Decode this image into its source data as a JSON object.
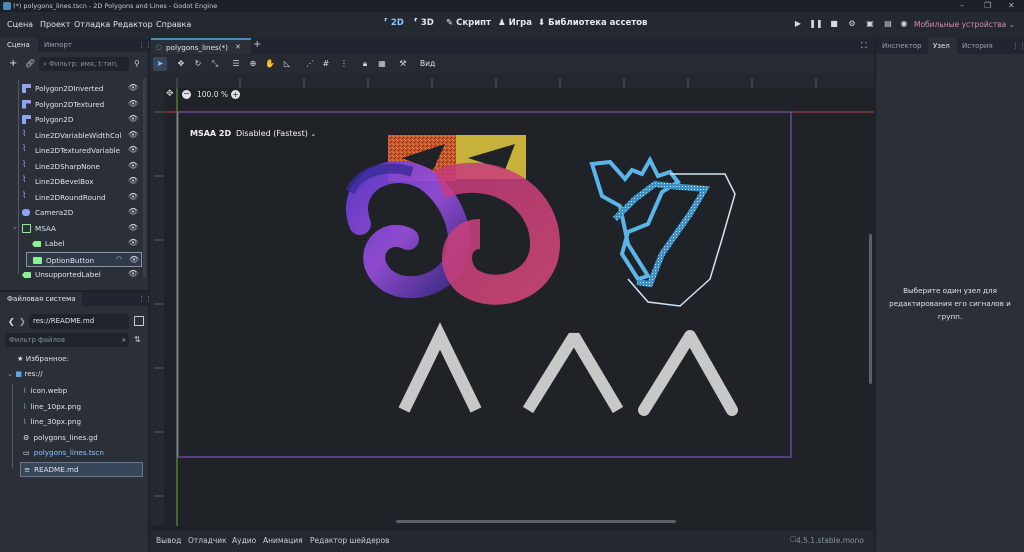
{
  "window": {
    "title": "(*) polygons_lines.tscn - 2D Polygons and Lines - Godot Engine"
  },
  "menu": [
    "Сцена",
    "Проект",
    "Отладка",
    "Редактор",
    "Справка"
  ],
  "workspaces": {
    "w2d": "2D",
    "w3d": "3D",
    "script": "Скрипт",
    "game": "Игра",
    "assets": "Библиотека ассетов"
  },
  "renderer": "Мобильные устройства",
  "scene_panel": {
    "tab_scene": "Сцена",
    "tab_import": "Импорт",
    "filter_placeholder": "Фильтр: имя, t:тип,",
    "nodes": [
      {
        "label": "Polygon2DInverted",
        "icon": "polygon2d-icon",
        "color": "#8da5f3"
      },
      {
        "label": "Polygon2DTextured",
        "icon": "polygon2d-icon",
        "color": "#8da5f3"
      },
      {
        "label": "Polygon2D",
        "icon": "polygon2d-icon",
        "color": "#8da5f3"
      },
      {
        "label": "Line2DVariableWidthCol",
        "icon": "line2d-icon",
        "color": "#8da5f3"
      },
      {
        "label": "Line2DTexturedVariable",
        "icon": "line2d-icon",
        "color": "#8da5f3"
      },
      {
        "label": "Line2DSharpNone",
        "icon": "line2d-icon",
        "color": "#8da5f3"
      },
      {
        "label": "Line2DBevelBox",
        "icon": "line2d-icon",
        "color": "#8da5f3"
      },
      {
        "label": "Line2DRoundRound",
        "icon": "line2d-icon",
        "color": "#8da5f3"
      },
      {
        "label": "Camera2D",
        "icon": "camera2d-icon",
        "color": "#8da5f3"
      },
      {
        "label": "MSAA",
        "icon": "container-icon",
        "color": "#8eef97"
      },
      {
        "label": "Label",
        "icon": "label-icon",
        "color": "#8eef97"
      },
      {
        "label": "OptionButton",
        "icon": "optionbutton-icon",
        "color": "#8eef97"
      },
      {
        "label": "UnsupportedLabel",
        "icon": "label-icon",
        "color": "#8eef97"
      }
    ]
  },
  "fs_panel": {
    "title": "Файловая система",
    "path": "res://README.md",
    "filter_placeholder": "Фильтр файлов",
    "favorites": "Избранное:",
    "root": "res://",
    "files": [
      {
        "label": "icon.webp",
        "icon": "image-icon"
      },
      {
        "label": "line_10px.png",
        "icon": "image-icon"
      },
      {
        "label": "line_30px.png",
        "icon": "image-icon"
      },
      {
        "label": "polygons_lines.gd",
        "icon": "gear-icon"
      },
      {
        "label": "polygons_lines.tscn",
        "icon": "scene-icon"
      },
      {
        "label": "README.md",
        "icon": "textfile-icon"
      }
    ]
  },
  "editor_tab": "polygons_lines(*)",
  "toolbar": {
    "view": "Вид"
  },
  "viewport": {
    "zoom": "100.0 %",
    "msaa_label": "MSAA 2D",
    "msaa_value": "Disabled (Fastest)"
  },
  "right_panel": {
    "tab_inspector": "Инспектор",
    "tab_node": "Узел",
    "tab_history": "История",
    "hint": "Выберите один узел для редактирования его сигналов и групп."
  },
  "bottom": {
    "output": "Вывод",
    "debugger": "Отладчик",
    "audio": "Аудио",
    "animation": "Анимация",
    "shader": "Редактор шейдеров",
    "version": "4.5.1.stable.mono"
  },
  "colors": {
    "accent": "#478cbf",
    "selection": "#37475b",
    "viewport_bg": "#1f2227",
    "renderer": "#e08aa8"
  }
}
